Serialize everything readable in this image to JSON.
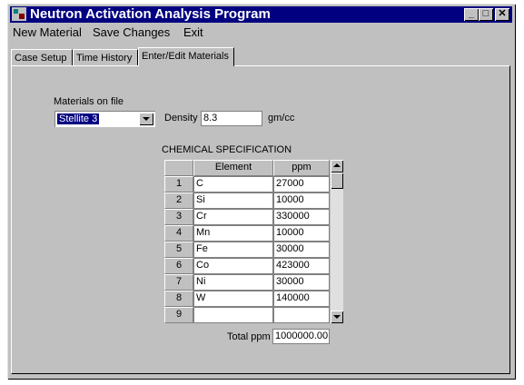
{
  "window": {
    "title": "Neutron Activation Analysis Program",
    "controls": {
      "minimize": "_",
      "maximize": "□",
      "close": "✕"
    }
  },
  "menu": {
    "new_material": "New Material",
    "save_changes": "Save Changes",
    "exit": "Exit"
  },
  "tabs": [
    "Case Setup",
    "Time History",
    "Enter/Edit Materials"
  ],
  "active_tab": "Enter/Edit Materials",
  "form": {
    "materials_label": "Materials on file",
    "material_selected": "Stellite 3",
    "density_label": "Density",
    "density_value": "8.3",
    "density_unit": "gm/cc",
    "chem_spec_title": "CHEMICAL SPECIFICATION"
  },
  "table": {
    "columns": [
      "Element",
      "ppm"
    ],
    "rows": [
      {
        "num": "1",
        "element": "C",
        "ppm": "27000"
      },
      {
        "num": "2",
        "element": "Si",
        "ppm": "10000"
      },
      {
        "num": "3",
        "element": "Cr",
        "ppm": "330000"
      },
      {
        "num": "4",
        "element": "Mn",
        "ppm": "10000"
      },
      {
        "num": "5",
        "element": "Fe",
        "ppm": "30000"
      },
      {
        "num": "6",
        "element": "Co",
        "ppm": "423000"
      },
      {
        "num": "7",
        "element": "Ni",
        "ppm": "30000"
      },
      {
        "num": "8",
        "element": "W",
        "ppm": "140000"
      },
      {
        "num": "9",
        "element": "",
        "ppm": ""
      }
    ],
    "total_label": "Total ppm",
    "total_value": "1000000.00"
  },
  "icons": {
    "app": "program-icon",
    "dropdown": "chevron-down-icon",
    "scroll_up": "arrow-up-icon",
    "scroll_down": "arrow-down-icon"
  }
}
